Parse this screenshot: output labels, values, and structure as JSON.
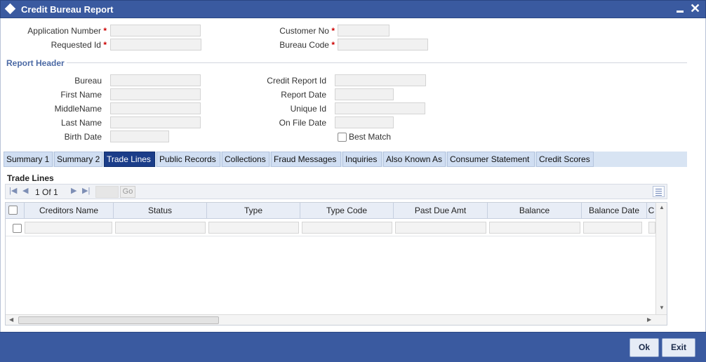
{
  "window": {
    "title": "Credit Bureau Report"
  },
  "form": {
    "application_number_label": "Application Number",
    "requested_id_label": "Requested Id",
    "customer_no_label": "Customer No",
    "bureau_code_label": "Bureau Code",
    "required_mark": "*"
  },
  "report_header": {
    "section_title": "Report Header",
    "bureau_label": "Bureau",
    "first_name_label": "First Name",
    "middle_name_label": "MiddleName",
    "last_name_label": "Last Name",
    "birth_date_label": "Birth Date",
    "credit_report_id_label": "Credit Report Id",
    "report_date_label": "Report Date",
    "unique_id_label": "Unique Id",
    "on_file_date_label": "On File Date",
    "best_match_label": "Best Match"
  },
  "tabs": [
    {
      "label": "Summary 1"
    },
    {
      "label": "Summary 2"
    },
    {
      "label": "Trade Lines",
      "active": true
    },
    {
      "label": "Public Records"
    },
    {
      "label": "Collections"
    },
    {
      "label": "Fraud Messages"
    },
    {
      "label": "Inquiries"
    },
    {
      "label": "Also Known As"
    },
    {
      "label": "Consumer Statement"
    },
    {
      "label": "Credit Scores"
    }
  ],
  "trade_lines": {
    "title": "Trade Lines",
    "pager": {
      "current_page": "1",
      "of_label": "Of",
      "total_pages": "1",
      "go_label": "Go"
    },
    "columns": [
      "Creditors Name",
      "Status",
      "Type",
      "Type Code",
      "Past Due Amt",
      "Balance",
      "Balance Date",
      "C"
    ]
  },
  "footer": {
    "ok_label": "Ok",
    "exit_label": "Exit"
  },
  "colors": {
    "title_bar": "#3a5aa0",
    "active_tab": "#1b3d89",
    "section_title": "#4c6aa5",
    "required": "#cc0000"
  }
}
